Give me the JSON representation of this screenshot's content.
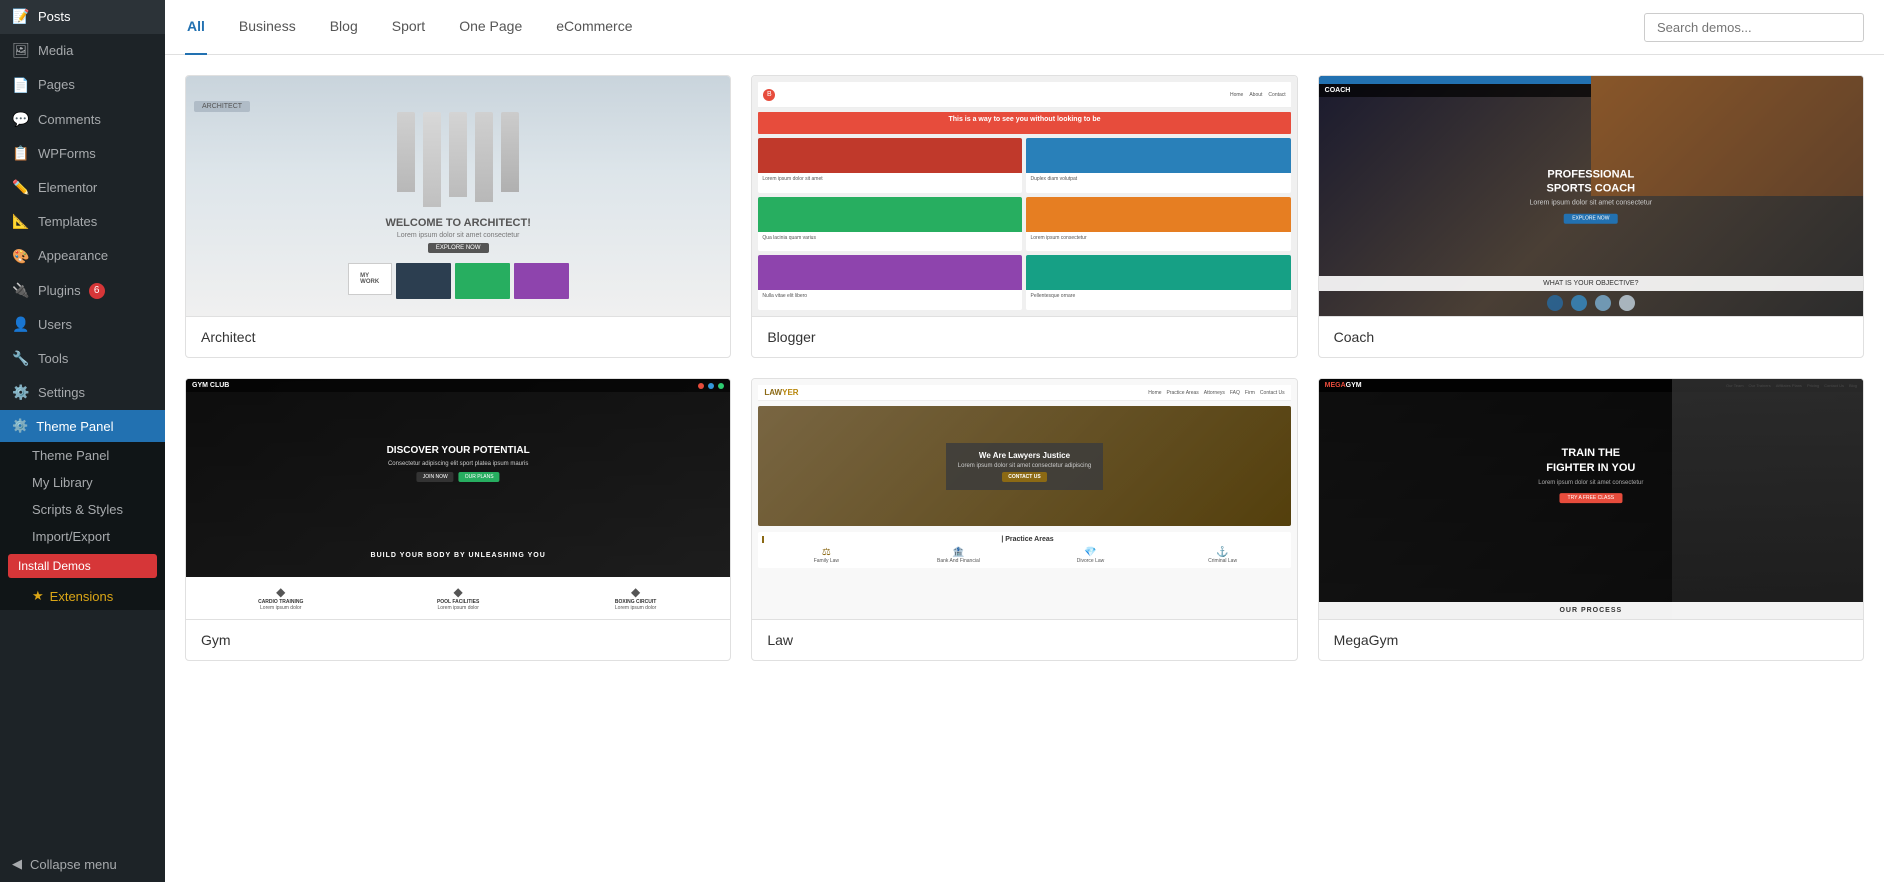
{
  "sidebar": {
    "items": [
      {
        "id": "posts",
        "label": "Posts",
        "icon": "📝",
        "badge": null
      },
      {
        "id": "media",
        "label": "Media",
        "icon": "🖼",
        "badge": null
      },
      {
        "id": "pages",
        "label": "Pages",
        "icon": "📄",
        "badge": null
      },
      {
        "id": "comments",
        "label": "Comments",
        "icon": "💬",
        "badge": null
      },
      {
        "id": "wpforms",
        "label": "WPForms",
        "icon": "📋",
        "badge": null
      },
      {
        "id": "elementor",
        "label": "Elementor",
        "icon": "✏️",
        "badge": null
      },
      {
        "id": "templates",
        "label": "Templates",
        "icon": "📐",
        "badge": null
      },
      {
        "id": "appearance",
        "label": "Appearance",
        "icon": "🎨",
        "badge": null
      },
      {
        "id": "plugins",
        "label": "Plugins",
        "icon": "🔌",
        "badge": "6"
      },
      {
        "id": "users",
        "label": "Users",
        "icon": "👤",
        "badge": null
      },
      {
        "id": "tools",
        "label": "Tools",
        "icon": "🔧",
        "badge": null
      },
      {
        "id": "settings",
        "label": "Settings",
        "icon": "⚙️",
        "badge": null
      }
    ],
    "theme_panel": {
      "label": "Theme Panel",
      "icon": "⚙️",
      "active": true
    },
    "submenu": {
      "items": [
        {
          "id": "theme-panel-sub",
          "label": "Theme Panel"
        },
        {
          "id": "my-library",
          "label": "My Library"
        },
        {
          "id": "scripts-styles",
          "label": "Scripts & Styles"
        },
        {
          "id": "import-export",
          "label": "Import/Export"
        },
        {
          "id": "install-demos",
          "label": "Install Demos",
          "highlight": true
        },
        {
          "id": "extensions",
          "label": "Extensions",
          "star": true
        }
      ]
    },
    "collapse": "Collapse menu"
  },
  "filter_bar": {
    "tabs": [
      {
        "id": "all",
        "label": "All",
        "active": true
      },
      {
        "id": "business",
        "label": "Business",
        "active": false
      },
      {
        "id": "blog",
        "label": "Blog",
        "active": false
      },
      {
        "id": "sport",
        "label": "Sport",
        "active": false
      },
      {
        "id": "one-page",
        "label": "One Page",
        "active": false
      },
      {
        "id": "ecommerce",
        "label": "eCommerce",
        "active": false
      }
    ],
    "search": {
      "placeholder": "Search demos..."
    }
  },
  "demos": [
    {
      "id": "architect",
      "title": "Architect",
      "type": "architect"
    },
    {
      "id": "blogger",
      "title": "Blogger",
      "type": "blogger"
    },
    {
      "id": "coach",
      "title": "Coach",
      "type": "coach"
    },
    {
      "id": "gym",
      "title": "Gym",
      "type": "gym"
    },
    {
      "id": "law",
      "title": "Law",
      "type": "law"
    },
    {
      "id": "megagym",
      "title": "MegaGym",
      "type": "megagym"
    }
  ]
}
